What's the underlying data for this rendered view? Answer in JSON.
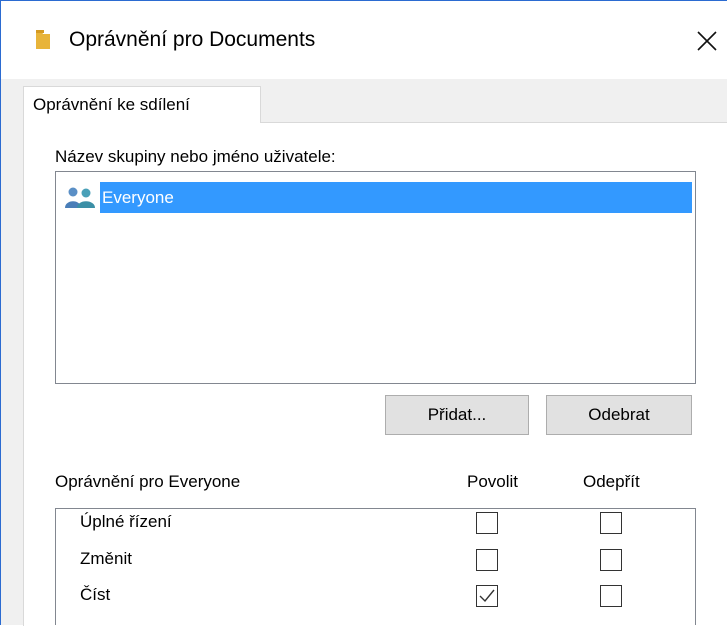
{
  "window": {
    "title": "Oprávnění pro Documents",
    "accent_color": "#2b6bd1"
  },
  "tabs": [
    {
      "label": "Oprávnění ke sdílení",
      "selected": true
    }
  ],
  "users_section": {
    "label": "Název skupiny nebo jméno uživatele:",
    "items": [
      {
        "name": "Everyone",
        "icon": "users-icon",
        "selected": true
      }
    ],
    "add_button": "Přidat...",
    "remove_button": "Odebrat"
  },
  "permissions": {
    "title": "Oprávnění pro Everyone",
    "allow_header": "Povolit",
    "deny_header": "Odepřít",
    "rows": [
      {
        "label": "Úplné řízení",
        "allow": false,
        "deny": false
      },
      {
        "label": "Změnit",
        "allow": false,
        "deny": false
      },
      {
        "label": "Číst",
        "allow": true,
        "deny": false
      }
    ]
  }
}
